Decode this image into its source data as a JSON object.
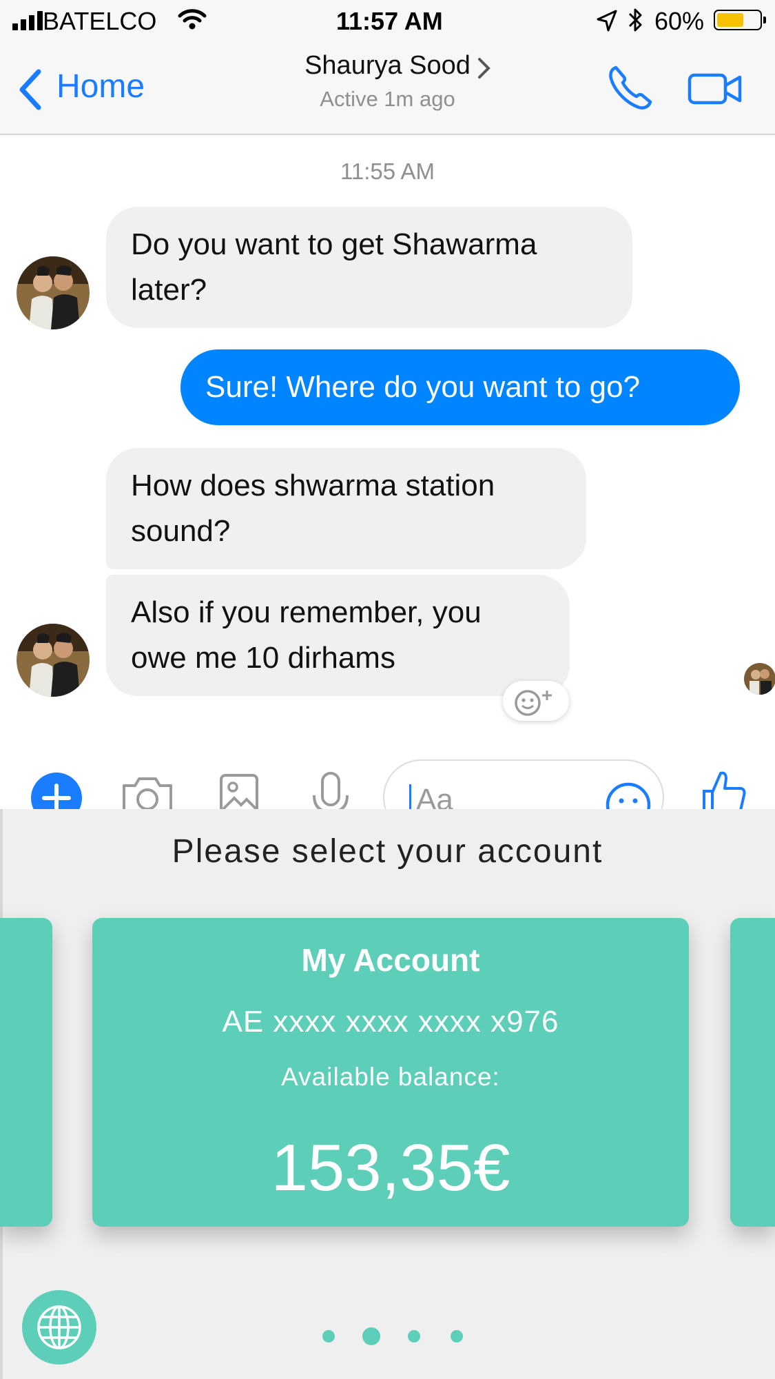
{
  "status_bar": {
    "carrier": "BATELCO",
    "time": "11:57 AM",
    "battery": "60%"
  },
  "nav": {
    "back_label": "Home",
    "contact_name": "Shaurya Sood",
    "contact_status": "Active 1m ago"
  },
  "conversation": {
    "timestamp": "11:55 AM",
    "messages": [
      {
        "from": "them",
        "lines": [
          "Do you want to get Shawarma",
          "later?"
        ]
      },
      {
        "from": "me",
        "lines": [
          "Sure! Where do you want to go?"
        ]
      },
      {
        "from": "them",
        "lines": [
          "How does shwarma station",
          "sound?"
        ]
      },
      {
        "from": "them",
        "lines": [
          "Also if you remember, you",
          "owe me 10 dirhams"
        ]
      }
    ]
  },
  "composer": {
    "placeholder": "Aa"
  },
  "account_sheet": {
    "title": "Please select your account",
    "card": {
      "name": "My Account",
      "iban": "AE xxxx xxxx xxxx x976",
      "balance_label": "Available balance:",
      "balance": "153,35€"
    },
    "pager": {
      "count": 4,
      "active_index": 1
    }
  },
  "colors": {
    "messenger_blue": "#0084ff",
    "accent_teal": "#5dcfb9"
  },
  "icons": [
    "signal-icon",
    "wifi-icon",
    "location-icon",
    "bluetooth-icon",
    "battery-icon",
    "back-chevron-icon",
    "chevron-right-icon",
    "phone-icon",
    "video-icon",
    "plus-icon",
    "camera-icon",
    "image-icon",
    "microphone-icon",
    "emoji-icon",
    "thumbs-up-icon",
    "globe-icon"
  ]
}
